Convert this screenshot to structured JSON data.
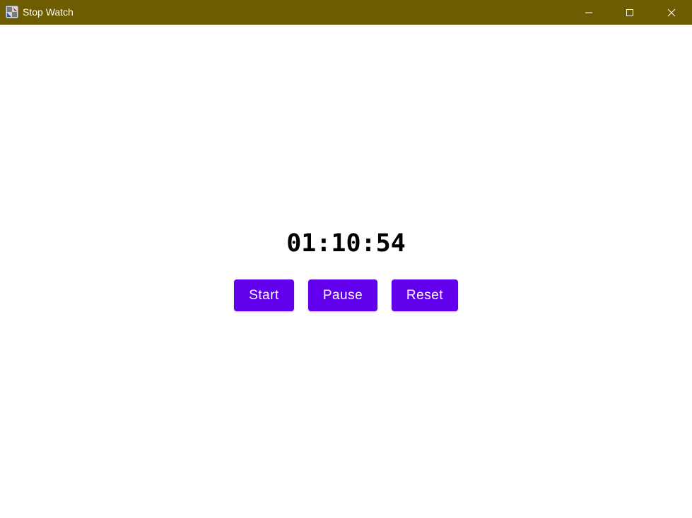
{
  "window": {
    "title": "Stop Watch",
    "titlebar_color": "#6e5c00",
    "icons": {
      "app": "app-icon",
      "minimize": "minimize-icon",
      "maximize": "maximize-icon",
      "close": "close-icon"
    }
  },
  "stopwatch": {
    "time": "01:10:54"
  },
  "buttons": {
    "start_label": "Start",
    "pause_label": "Pause",
    "reset_label": "Reset",
    "color": "#6200ee"
  }
}
